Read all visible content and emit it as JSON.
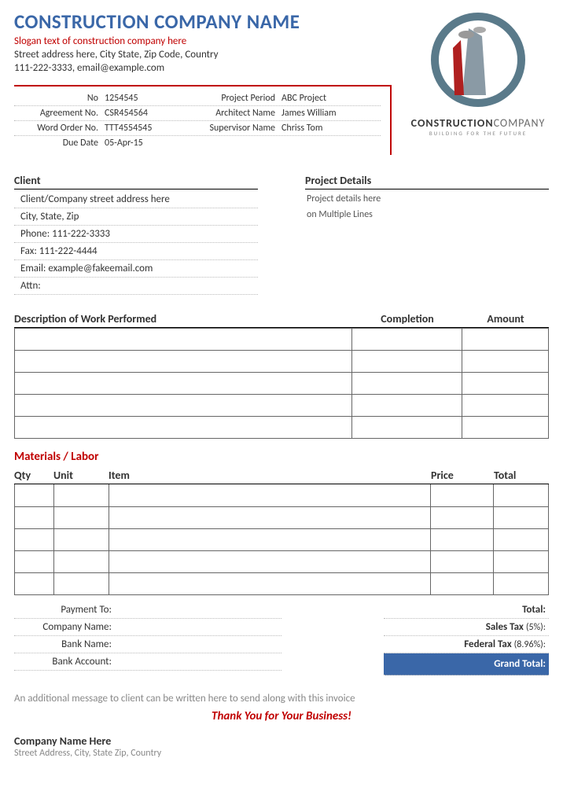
{
  "header": {
    "company_name": "CONSTRUCTION COMPANY NAME",
    "slogan": "Slogan text of construction company here",
    "address": "Street address here, City State, Zip Code, Country",
    "contact": "111-222-3333, email@example.com",
    "logo_line1_a": "CONSTRUCTION",
    "logo_line1_b": "COMPANY",
    "logo_line2": "BUILDING FOR THE FUTURE"
  },
  "info": {
    "no_lbl": "No",
    "no_val": "1254545",
    "period_lbl": "Project Period",
    "period_val": "ABC Project",
    "agreement_lbl": "Agreement No.",
    "agreement_val": "CSR454564",
    "architect_lbl": "Architect Name",
    "architect_val": "James William",
    "workorder_lbl": "Word Order No.",
    "workorder_val": "TTT4554545",
    "supervisor_lbl": "Supervisor Name",
    "supervisor_val": "Chriss Tom",
    "due_lbl": "Due Date",
    "due_val": "05-Apr-15"
  },
  "client": {
    "heading": "Client",
    "addr": "Client/Company street address here",
    "csz": "City, State, Zip",
    "phone": "Phone: 111-222-3333",
    "fax": "Fax: 111-222-4444",
    "email": "Email: example@fakeemail.com",
    "attn": "Attn:"
  },
  "project": {
    "heading": "Project Details",
    "line1": "Project details here",
    "line2": "on Multiple Lines"
  },
  "work": {
    "desc_h": "Description of Work Performed",
    "comp_h": "Completion",
    "amt_h": "Amount"
  },
  "materials": {
    "title": "Materials / Labor",
    "qty_h": "Qty",
    "unit_h": "Unit",
    "item_h": "Item",
    "price_h": "Price",
    "total_h": "Total"
  },
  "payment": {
    "to": "Payment To:",
    "company": "Company Name:",
    "bank": "Bank Name:",
    "account": "Bank Account:"
  },
  "totals": {
    "total": "Total:",
    "sales_lbl": "Sales Tax",
    "sales_pct": "(5%):",
    "fed_lbl": "Federal Tax",
    "fed_pct": "(8.96%):",
    "grand": "Grand Total:"
  },
  "footer": {
    "msg": "An additional message to client can be written here to send along with this invoice",
    "thanks": "Thank You for Your Business!",
    "company": "Company Name Here",
    "addr": "Street Address, City, State Zip, Country"
  }
}
